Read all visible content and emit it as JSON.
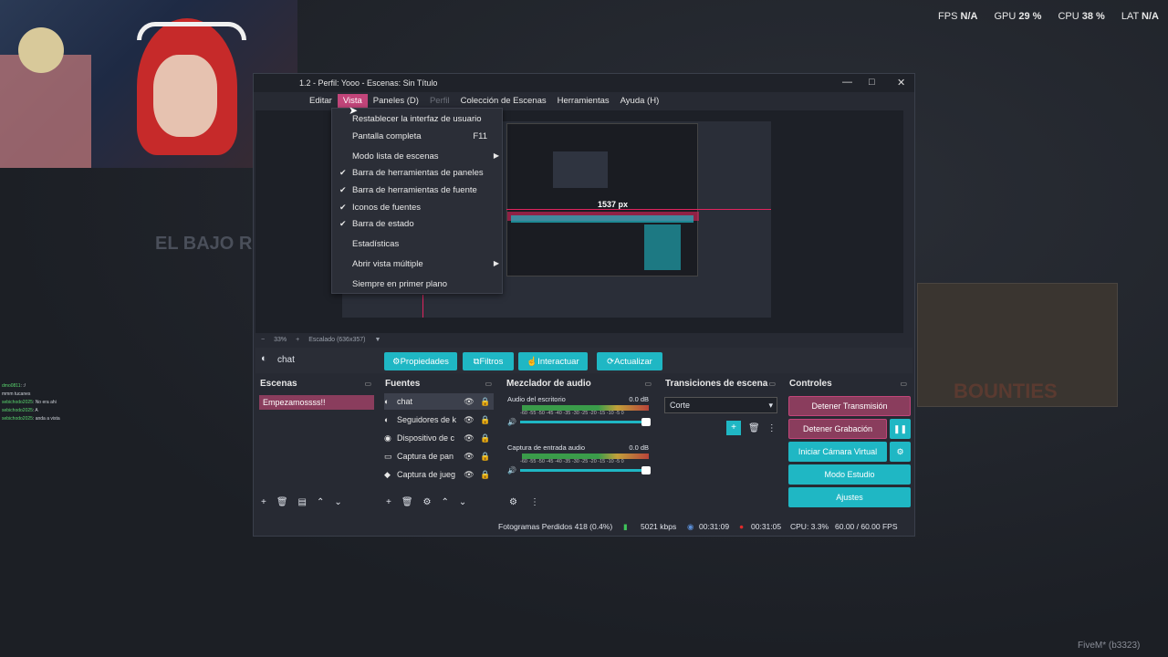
{
  "overlay_stats": {
    "fps_label": "FPS",
    "fps_value": "N/A",
    "gpu_label": "GPU",
    "gpu_value": "29 %",
    "cpu_label": "CPU",
    "cpu_value": "38 %",
    "lat_label": "LAT",
    "lat_value": "N/A"
  },
  "background": {
    "game_title": "EL BAJO R",
    "bounties_text": "BOUNTIES",
    "fivem_label": "FiveM* (b3323)"
  },
  "chat": [
    {
      "user": "dmo0811",
      "msg": ": :/"
    },
    {
      "user": "",
      "msg": "mmm tucanes"
    },
    {
      "user": "sebichodo2025",
      "msg": ": No era ahi"
    },
    {
      "user": "sebichodo2025",
      "msg": ": A"
    },
    {
      "user": "sebichodo2025",
      "msg": ": anda a vista"
    }
  ],
  "window": {
    "title": "1.2 - Perfil: Yooo - Escenas: Sin Título",
    "controls": {
      "minimize": "—",
      "maximize": "□",
      "close": "✕"
    }
  },
  "menu": {
    "items": [
      "Editar",
      "Vista",
      "Paneles (D)",
      "Perfil",
      "Colección de Escenas",
      "Herramientas",
      "Ayuda (H)"
    ],
    "active": "Vista",
    "disabled": "Perfil"
  },
  "dropdown": {
    "items": [
      {
        "label": "Restablecer la interfaz de usuario",
        "checked": false,
        "shortcut": "",
        "submenu": false
      },
      {
        "label": "Pantalla completa",
        "checked": false,
        "shortcut": "F11",
        "submenu": false
      },
      {
        "label": "Modo lista de escenas",
        "checked": false,
        "shortcut": "",
        "submenu": true
      },
      {
        "label": "Barra de herramientas de paneles",
        "checked": true,
        "shortcut": "",
        "submenu": false
      },
      {
        "label": "Barra de herramientas de fuente",
        "checked": true,
        "shortcut": "",
        "submenu": false
      },
      {
        "label": "Iconos de fuentes",
        "checked": true,
        "shortcut": "",
        "submenu": false
      },
      {
        "label": "Barra de estado",
        "checked": true,
        "shortcut": "",
        "submenu": false
      },
      {
        "label": "Estadísticas",
        "checked": false,
        "shortcut": "",
        "submenu": false
      },
      {
        "label": "Abrir vista múltiple",
        "checked": false,
        "shortcut": "",
        "submenu": true
      },
      {
        "label": "Siempre en primer plano",
        "checked": false,
        "shortcut": "",
        "submenu": false
      }
    ]
  },
  "preview": {
    "measure": "1537 px",
    "zoom": "33%",
    "scaling": "Escalado (636x357)"
  },
  "source_toolbar": {
    "selected_source": "chat",
    "buttons": {
      "properties": "Propiedades",
      "filters": "Filtros",
      "interact": "Interactuar",
      "refresh": "Actualizar"
    }
  },
  "scenes": {
    "title": "Escenas",
    "items": [
      "Empezamossss!!"
    ]
  },
  "sources": {
    "title": "Fuentes",
    "items": [
      {
        "icon": "◐",
        "name": "chat"
      },
      {
        "icon": "◐",
        "name": "Seguidores de k"
      },
      {
        "icon": "◉",
        "name": "Dispositivo de c"
      },
      {
        "icon": "▭",
        "name": "Captura de pan"
      },
      {
        "icon": "◆",
        "name": "Captura de jueg"
      }
    ]
  },
  "mixer": {
    "title": "Mezclador de audio",
    "scale": "-60 -55 -50 -45 -40 -35 -30 -25 -20 -15 -10 -5 0",
    "channels": [
      {
        "name": "Audio del escritorio",
        "db": "0.0 dB"
      },
      {
        "name": "Captura de entrada audio",
        "db": "0.0 dB"
      }
    ]
  },
  "transitions": {
    "title": "Transiciones de escena",
    "selected": "Corte"
  },
  "controls": {
    "title": "Controles",
    "stop_stream": "Detener Transmisión",
    "stop_record": "Detener Grabación",
    "virtual_cam": "Iniciar Cámara Virtual",
    "studio_mode": "Modo Estudio",
    "settings": "Ajustes"
  },
  "status": {
    "dropped": "Fotogramas Perdidos 418 (0.4%)",
    "bitrate": "5021 kbps",
    "stream_time": "00:31:09",
    "rec_time": "00:31:05",
    "cpu": "CPU: 3.3%",
    "fps": "60.00 / 60.00 FPS"
  },
  "colors": {
    "accent_cyan": "#1fb7c4",
    "accent_pink": "#c2457a",
    "stop_btn": "#8a3d5d"
  }
}
